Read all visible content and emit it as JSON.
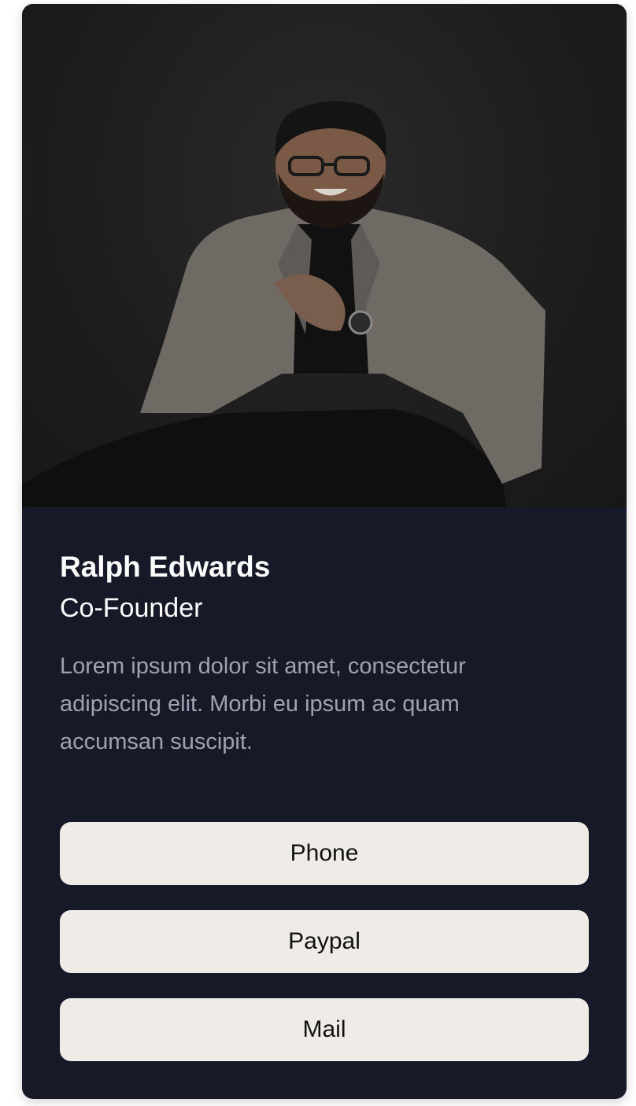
{
  "profile": {
    "name": "Ralph Edwards",
    "role": "Co-Founder",
    "description": "Lorem ipsum dolor sit amet, consectetur adipiscing elit. Morbi eu ipsum ac quam accumsan suscipit."
  },
  "buttons": {
    "phone": "Phone",
    "paypal": "Paypal",
    "mail": "Mail"
  },
  "colors": {
    "card_background": "#151928",
    "button_background": "#efece7",
    "description_text": "#9ea3b0"
  }
}
